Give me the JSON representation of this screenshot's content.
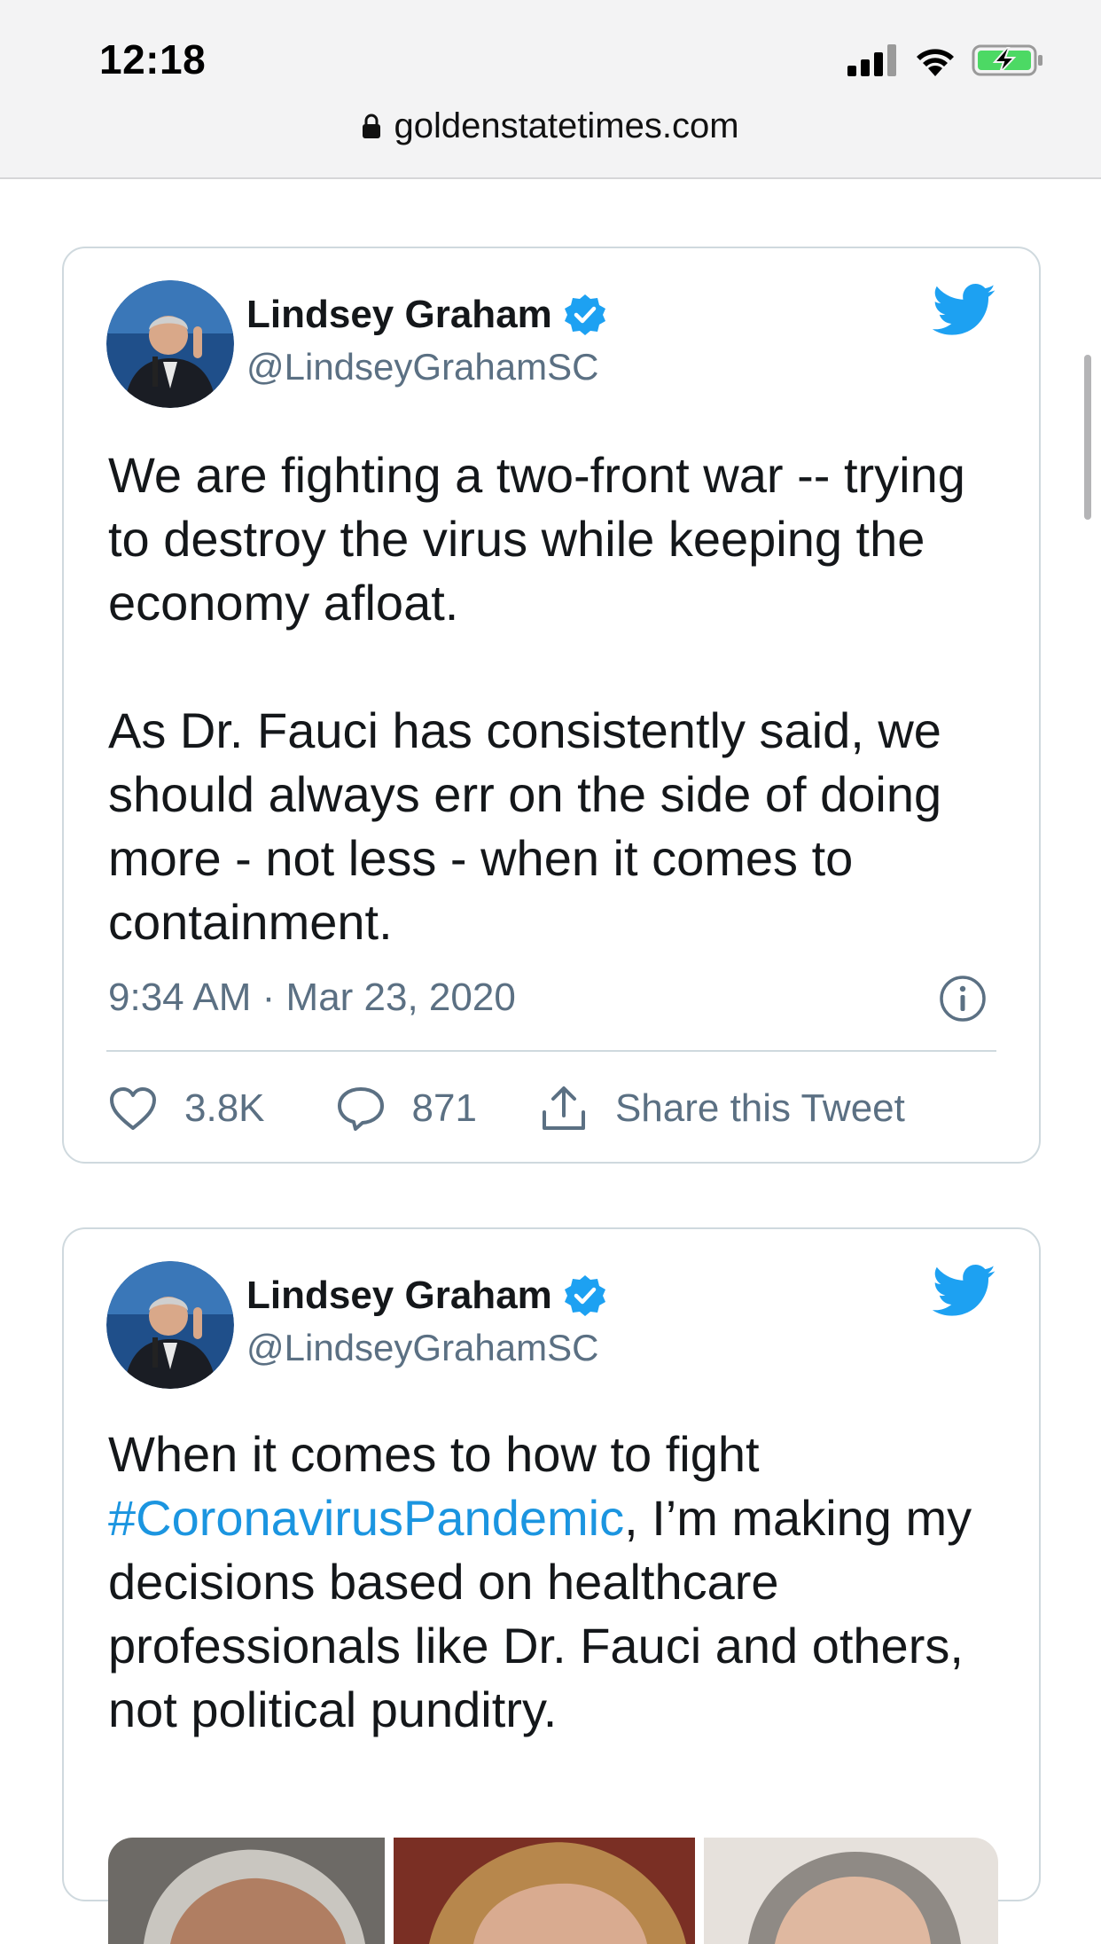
{
  "status_bar": {
    "time": "12:18",
    "icons": [
      "signal-icon",
      "wifi-icon",
      "battery-charging-icon"
    ],
    "battery_color": "#4cd964"
  },
  "browser": {
    "url": "goldenstatetimes.com",
    "lock_icon": "lock-icon"
  },
  "colors": {
    "twitter_blue": "#1da1f2",
    "hashtag": "#1b95e0",
    "secondary_text": "#5b7083",
    "border": "#cfd9de"
  },
  "tweets": [
    {
      "display_name": "Lindsey Graham",
      "handle": "@LindseyGrahamSC",
      "verified": true,
      "paragraphs": [
        "We are fighting a two-front war -- trying to destroy the virus while keeping the economy afloat.",
        "As Dr. Fauci has consistently said, we should always err on the side of doing more - not less - when it comes to containment."
      ],
      "timestamp": "9:34 AM · Mar 23, 2020",
      "likes": "3.8K",
      "replies": "871",
      "share_label": "Share this Tweet"
    },
    {
      "display_name": "Lindsey Graham",
      "handle": "@LindseyGrahamSC",
      "verified": true,
      "body_before": "When it comes to how to fight ",
      "hashtag": "#CoronavirusPandemic",
      "body_after": ", I’m making my decisions based on healthcare professionals like Dr. Fauci and others, not political punditry.",
      "media_count": 3
    }
  ]
}
